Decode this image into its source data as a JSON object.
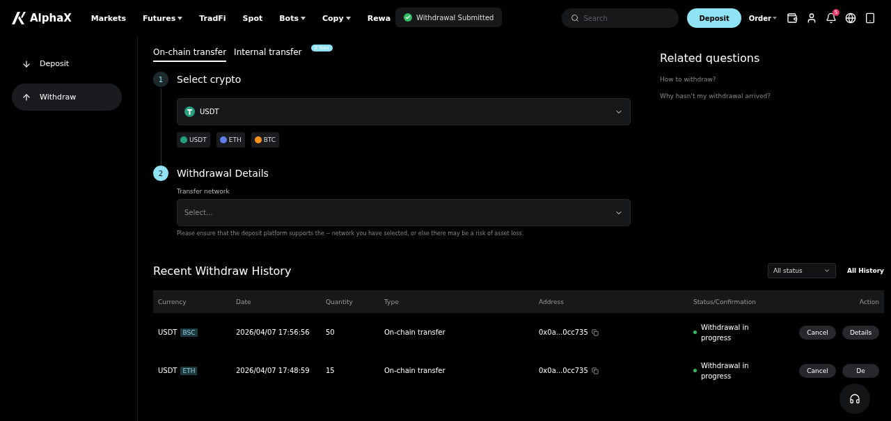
{
  "header": {
    "logo": "AlphaX",
    "nav": [
      {
        "label": "Markets",
        "dropdown": false
      },
      {
        "label": "Futures",
        "dropdown": true
      },
      {
        "label": "TradFi",
        "dropdown": false
      },
      {
        "label": "Spot",
        "dropdown": false
      },
      {
        "label": "Bots",
        "dropdown": true
      },
      {
        "label": "Copy",
        "dropdown": true
      },
      {
        "label": "Rewa",
        "dropdown": false
      }
    ],
    "search": {
      "placeholder": "Search"
    },
    "deposit_button": "Deposit",
    "order_menu": "Order",
    "notification_count": "5"
  },
  "toast": {
    "message": "Withdrawal Submitted"
  },
  "sidebar": {
    "items": [
      {
        "label": "Deposit",
        "selected": false
      },
      {
        "label": "Withdraw",
        "selected": true
      }
    ]
  },
  "tabs": [
    {
      "label": "On-chain transfer",
      "selected": true
    },
    {
      "label": "Internal transfer",
      "selected": false,
      "badge": "0 fees"
    }
  ],
  "steps": [
    {
      "number": "1",
      "title": "Select crypto",
      "active": false
    },
    {
      "number": "2",
      "title": "Withdrawal Details",
      "active": true
    }
  ],
  "crypto_select": {
    "value": "USDT"
  },
  "quick_coins": [
    {
      "label": "USDT",
      "color": "#26a17b"
    },
    {
      "label": "ETH",
      "color": "#627eea"
    },
    {
      "label": "BTC",
      "color": "#f7931a"
    }
  ],
  "network": {
    "label": "Transfer network",
    "placeholder": "Select...",
    "hint": "Please ensure that the deposit platform supports the -- network you have selected, or else there may be a risk of asset loss."
  },
  "related": {
    "title": "Related questions",
    "links": [
      "How to withdraw?",
      "Why hasn't my withdrawal arrived?"
    ]
  },
  "history": {
    "title": "Recent Withdraw History",
    "status_filter": "All status",
    "all_link": "All History",
    "columns": [
      "Currency",
      "Date",
      "Quantity",
      "Type",
      "Address",
      "Status/Confirmation",
      "Action"
    ],
    "rows": [
      {
        "currency": "USDT",
        "network": "BSC",
        "date": "2026/04/07 17:56:56",
        "quantity": "50",
        "type": "On-chain transfer",
        "address": "0x0a...0cc735",
        "status": "Withdrawal in progress",
        "color": "#2ebd5f",
        "actions": [
          "Cancel",
          "Details"
        ]
      },
      {
        "currency": "USDT",
        "network": "ETH",
        "date": "2026/04/07 17:48:59",
        "quantity": "15",
        "type": "On-chain transfer",
        "address": "0x0a...0cc735",
        "status": "Withdrawal in progress",
        "color": "#2ebd5f",
        "actions": [
          "Cancel",
          "De"
        ]
      }
    ]
  }
}
